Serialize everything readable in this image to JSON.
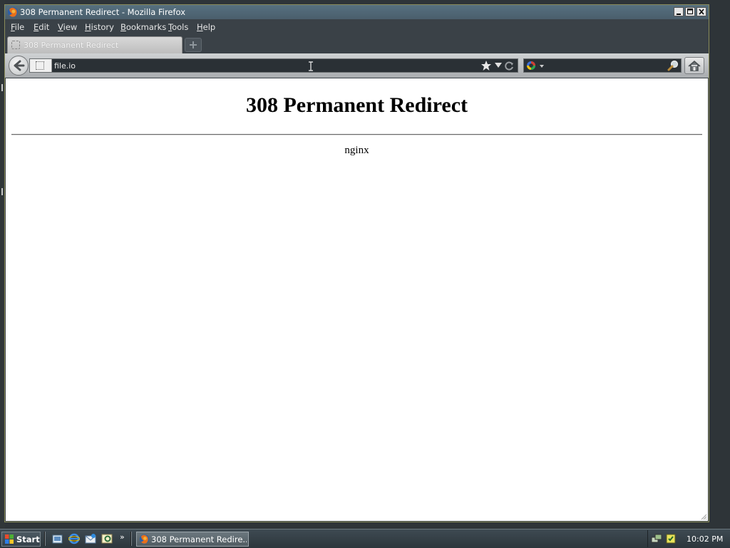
{
  "window": {
    "title": "308 Permanent Redirect - Mozilla Firefox",
    "controls": [
      "minimize",
      "maximize",
      "close"
    ]
  },
  "menubar": {
    "items": [
      {
        "label": "File",
        "access_key": "F",
        "rest": "ile"
      },
      {
        "label": "Edit",
        "access_key": "E",
        "rest": "dit"
      },
      {
        "label": "View",
        "access_key": "V",
        "rest": "iew"
      },
      {
        "label": "History",
        "access_key": "H",
        "rest": "istory"
      },
      {
        "label": "Bookmarks",
        "access_key": "B",
        "rest": "ookmarks"
      },
      {
        "label": "Tools",
        "access_key": "T",
        "rest": "ools"
      },
      {
        "label": "Help",
        "access_key": "H",
        "rest": "elp"
      }
    ]
  },
  "tabs": [
    {
      "label": "308 Permanent Redirect",
      "active": true
    }
  ],
  "navbar": {
    "url": "file.io",
    "search_engine": "google",
    "icons": [
      "back-icon",
      "star-icon",
      "reload-icon",
      "search-go-icon",
      "home-icon"
    ]
  },
  "content": {
    "heading": "308 Permanent Redirect",
    "server": "nginx"
  },
  "taskbar": {
    "start_label": "Start",
    "quicklaunch": [
      "show-desktop-icon",
      "internet-explorer-icon",
      "outlook-express-icon",
      "media-icon"
    ],
    "chevron": "»",
    "task_label": "308 Permanent Redire...",
    "clock": "10:02 PM",
    "tray_icons": [
      "network-icon",
      "security-icon"
    ]
  },
  "colors": {
    "titlebar": "#4f6877",
    "chrome": "#3a4147",
    "content_bg": "#ffffff",
    "taskbar": "#35414a"
  }
}
